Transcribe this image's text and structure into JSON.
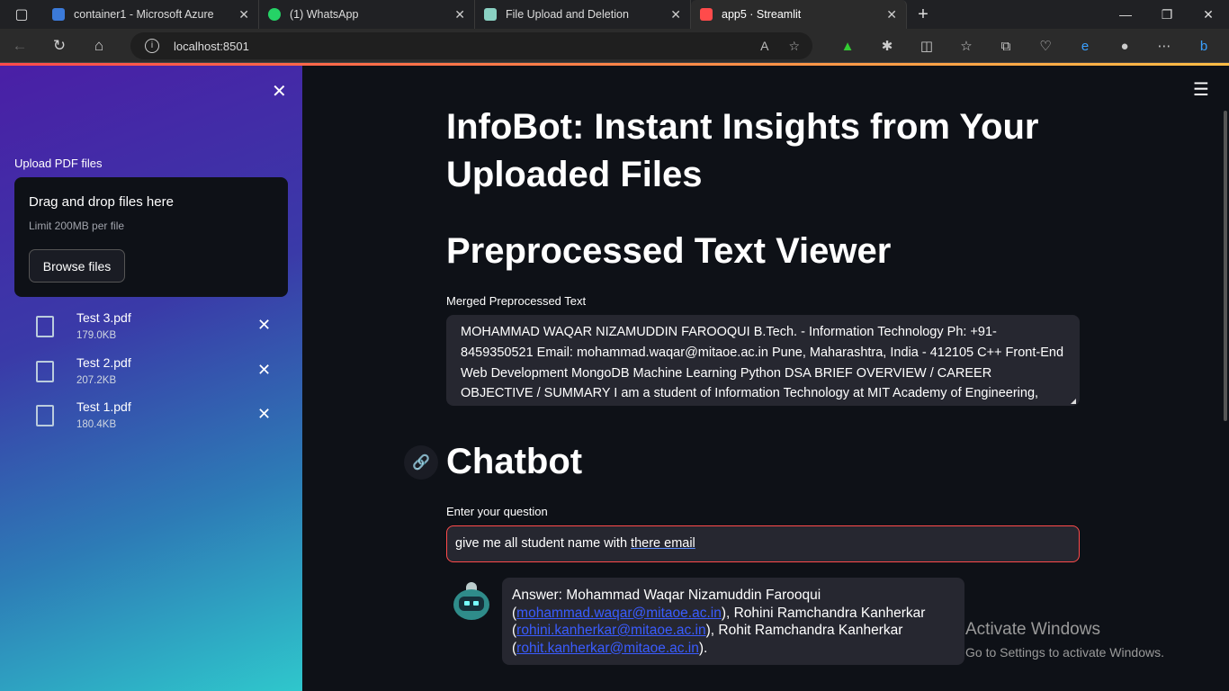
{
  "browser": {
    "tabs": [
      {
        "title": "container1 - Microsoft Azure",
        "color": "#3b7ad9"
      },
      {
        "title": "(1) WhatsApp",
        "color": "#25d366"
      },
      {
        "title": "File Upload and Deletion",
        "color": "#8ad1c3"
      },
      {
        "title": "app5 · Streamlit",
        "color": "#ff4b4b"
      }
    ],
    "url": "localhost:8501"
  },
  "sidebar": {
    "upload_label": "Upload PDF files",
    "dropzone_title": "Drag and drop files here",
    "dropzone_limit": "Limit 200MB per file",
    "browse_button": "Browse files",
    "files": [
      {
        "name": "Test 3.pdf",
        "size": "179.0KB"
      },
      {
        "name": "Test 2.pdf",
        "size": "207.2KB"
      },
      {
        "name": "Test 1.pdf",
        "size": "180.4KB"
      }
    ]
  },
  "main": {
    "title": "InfoBot: Instant Insights from Your Uploaded Files",
    "viewer_heading": "Preprocessed Text Viewer",
    "merged_label": "Merged Preprocessed Text",
    "merged_text": "MOHAMMAD WAQAR NIZAMUDDIN FAROOQUI B.Tech. - Information Technology Ph: +91-8459350521 Email: mohammad.waqar@mitaoe.ac.in Pune, Maharashtra, India - 412105 C++ Front-End Web Development MongoDB Machine Learning Python DSA BRIEF OVERVIEW / CAREER OBJECTIVE / SUMMARY I am a student of Information Technology at MIT Academy of Engineering,",
    "chatbot_heading": "Chatbot",
    "question_label": "Enter your question",
    "question_value_a": "give me all student name with ",
    "question_value_b": "there email",
    "answer": {
      "p1": "Answer: Mohammad Waqar Nizamuddin Farooqui (",
      "l1": "mohammad.waqar@mitaoe.ac.in",
      "p2": "), Rohini Ramchandra Kanherkar (",
      "l2": "rohini.kanherkar@mitaoe.ac.in",
      "p3": "), Rohit Ramchandra Kanherkar (",
      "l3": "rohit.kanherkar@mitaoe.ac.in",
      "p4": ")."
    }
  },
  "watermark": {
    "line1": "Activate Windows",
    "line2": "Go to Settings to activate Windows."
  }
}
